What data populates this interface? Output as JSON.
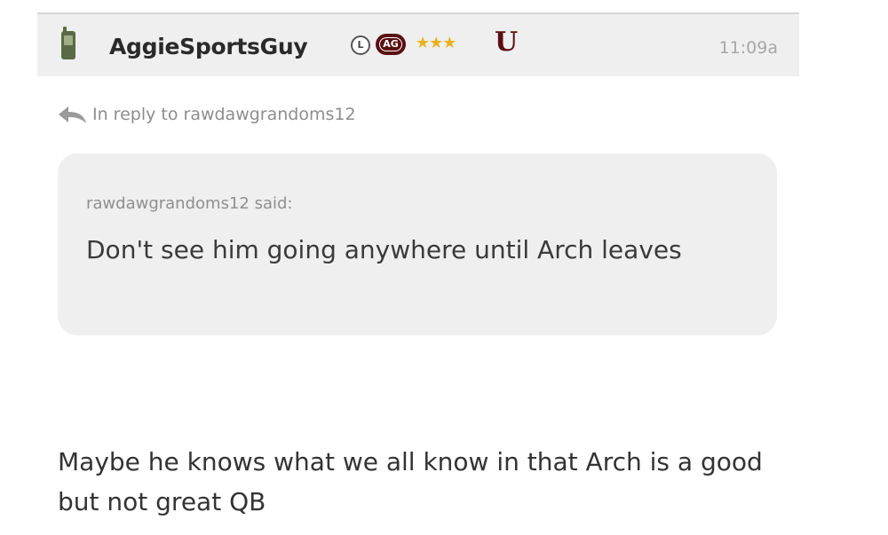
{
  "post": {
    "author": {
      "username": "AggieSportsGuy",
      "device_icon": "mobile-phone-icon",
      "badge_l": "L",
      "badge_ag": "AG",
      "stars": "★★★",
      "u_badge": "U"
    },
    "timestamp": "11:09a",
    "reply_to": "In reply to rawdawgrandoms12",
    "quote": {
      "author_line": "rawdawgrandoms12 said:",
      "text": "Don't see him going anywhere until Arch leaves"
    },
    "body": "Maybe he knows what we all know in that Arch is a good but not great QB"
  },
  "colors": {
    "header_bg": "#efefef",
    "maroon": "#5a0f12",
    "star_gold": "#e8b21c",
    "quote_bg": "#efefef",
    "muted_text": "#8d8d8d"
  }
}
